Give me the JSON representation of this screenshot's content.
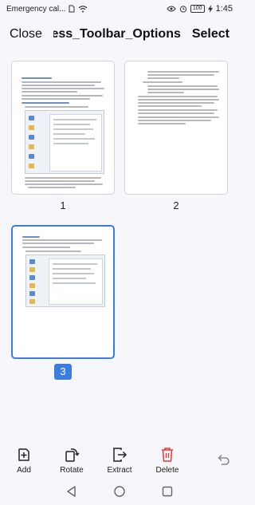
{
  "status": {
    "carrier": "Emergency cal...",
    "battery": "100",
    "time": "1:45"
  },
  "header": {
    "close_label": "Close",
    "title": "Access_Toolbar_Options",
    "select_label": "Select"
  },
  "pages": [
    {
      "number": "1",
      "selected": false
    },
    {
      "number": "2",
      "selected": false
    },
    {
      "number": "3",
      "selected": true
    }
  ],
  "toolbar": {
    "add_label": "Add",
    "rotate_label": "Rotate",
    "extract_label": "Extract",
    "delete_label": "Delete"
  },
  "icons": {
    "add": "add-page-icon",
    "rotate": "rotate-icon",
    "extract": "extract-icon",
    "delete": "trash-icon",
    "undo": "undo-icon"
  },
  "colors": {
    "accent": "#3b7de0",
    "delete": "#e53935",
    "background": "#f6f6fb"
  }
}
